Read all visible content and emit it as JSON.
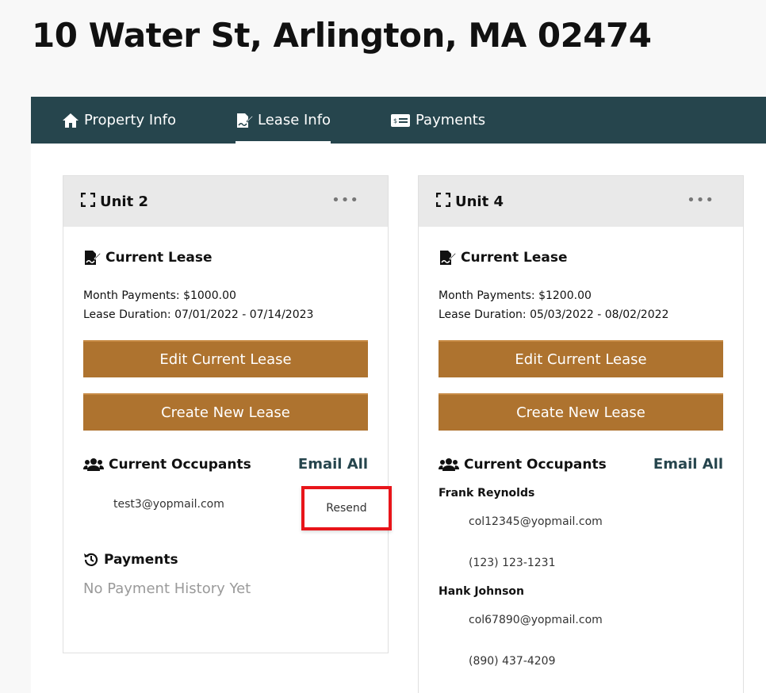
{
  "header": {
    "title": "10 Water St, Arlington, MA 02474"
  },
  "tabs": [
    {
      "label": "Property Info",
      "icon": "home-icon",
      "active": false
    },
    {
      "label": "Lease Info",
      "icon": "lease-icon",
      "active": true
    },
    {
      "label": "Payments",
      "icon": "payment-card-icon",
      "active": false
    }
  ],
  "units": [
    {
      "title": "Unit 2",
      "lease_heading": "Current Lease",
      "monthly": "Month Payments: $1000.00",
      "duration": "Lease Duration: 07/01/2022 - 07/14/2023",
      "edit_label": "Edit Current Lease",
      "create_label": "Create New Lease",
      "occupants_heading": "Current Occupants",
      "email_all": "Email All",
      "occupant_email": "test3@yopmail.com",
      "resend_label": "Resend",
      "payments_heading": "Payments",
      "payments_empty": "No Payment History Yet"
    },
    {
      "title": "Unit 4",
      "lease_heading": "Current Lease",
      "monthly": "Month Payments: $1200.00",
      "duration": "Lease Duration: 05/03/2022 - 08/02/2022",
      "edit_label": "Edit Current Lease",
      "create_label": "Create New Lease",
      "occupants_heading": "Current Occupants",
      "email_all": "Email All",
      "occupants": [
        {
          "name": "Frank Reynolds",
          "email": "col12345@yopmail.com",
          "phone": "(123) 123-1231"
        },
        {
          "name": "Hank Johnson",
          "email": "col67890@yopmail.com",
          "phone": "(890) 437-4209"
        }
      ]
    }
  ],
  "colors": {
    "tabbar": "#26454d",
    "button": "#ae732f",
    "highlight": "#e8151a"
  }
}
